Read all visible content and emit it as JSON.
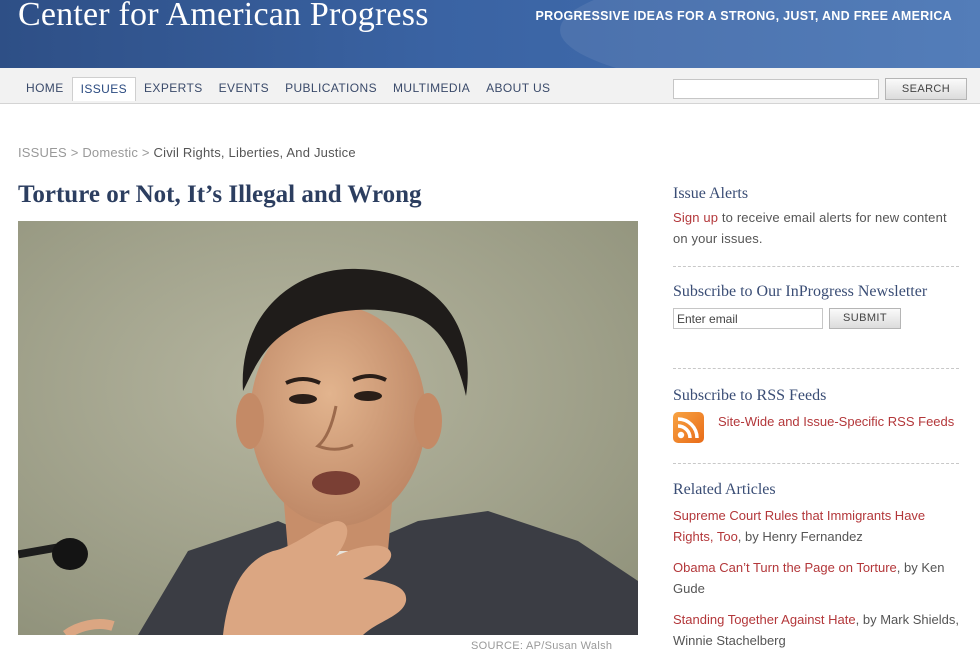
{
  "header": {
    "site_title": "Center for American Progress",
    "tagline": "PROGRESSIVE IDEAS FOR A STRONG, JUST, AND FREE AMERICA",
    "brand_color": "#3a63a3"
  },
  "nav": {
    "items": [
      "HOME",
      "ISSUES",
      "EXPERTS",
      "EVENTS",
      "PUBLICATIONS",
      "MULTIMEDIA",
      "ABOUT US"
    ],
    "active": "ISSUES",
    "search_value": "",
    "search_button": "SEARCH"
  },
  "breadcrumb": {
    "items": [
      "ISSUES",
      "Domestic",
      "Civil Rights, Liberties, And Justice"
    ],
    "separator": ">"
  },
  "article": {
    "title": "Torture or Not, It’s Illegal and Wrong",
    "photo_credit": "SOURCE: AP/Susan Walsh"
  },
  "sidebar": {
    "issue_alerts": {
      "heading": "Issue Alerts",
      "link": "Sign up",
      "text": " to receive email alerts for new content on your issues."
    },
    "newsletter": {
      "heading": "Subscribe to Our InProgress Newsletter",
      "email_value": "Enter email",
      "submit": "SUBMIT"
    },
    "rss": {
      "heading": "Subscribe to RSS Feeds",
      "link": "Site-Wide and Issue-Specific RSS Feeds",
      "icon": "rss-icon"
    },
    "related": {
      "heading": "Related Articles",
      "items": [
        {
          "title": "Supreme Court Rules that Immigrants Have Rights, Too",
          "byline": ", by Henry Fernandez"
        },
        {
          "title": "Obama Can’t Turn the Page on Torture",
          "byline": ", by Ken Gude"
        },
        {
          "title": "Standing Together Against Hate",
          "byline": ", by Mark Shields, Winnie Stachelberg"
        }
      ]
    },
    "link_color": "#b3373a"
  }
}
